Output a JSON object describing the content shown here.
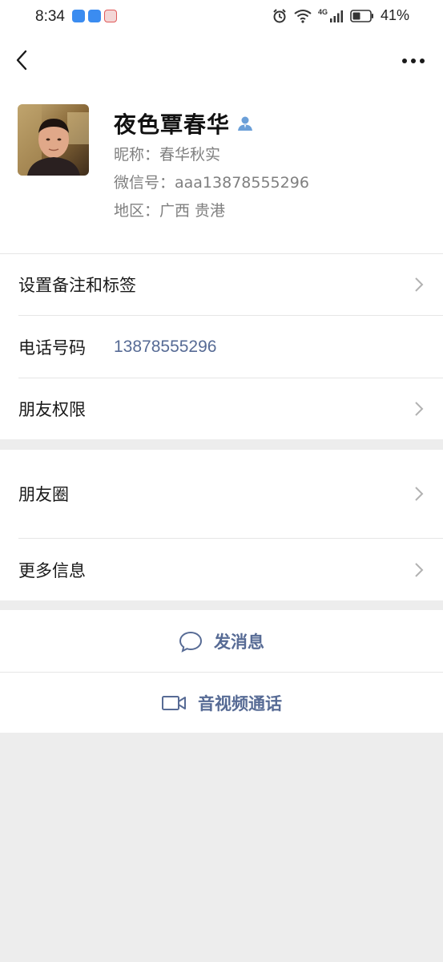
{
  "status_bar": {
    "time": "8:34",
    "network": "4G",
    "battery": "41%"
  },
  "profile": {
    "remark_name": "夜色覃春华",
    "nickname": "昵称：春华秋实",
    "wechat_id": "微信号：aaa13878555296",
    "region": "地区：广西  贵港"
  },
  "menu": {
    "set_remark": "设置备注和标签",
    "phone_label": "电话号码",
    "phone_value": "13878555296",
    "friend_permissions": "朋友权限",
    "moments": "朋友圈",
    "more_info": "更多信息"
  },
  "actions": {
    "send_message": "发消息",
    "video_call": "音视频通话"
  },
  "colors": {
    "link": "#576b95",
    "background": "#ededed",
    "text": "#191919",
    "secondary_text": "#7f7f7f"
  }
}
